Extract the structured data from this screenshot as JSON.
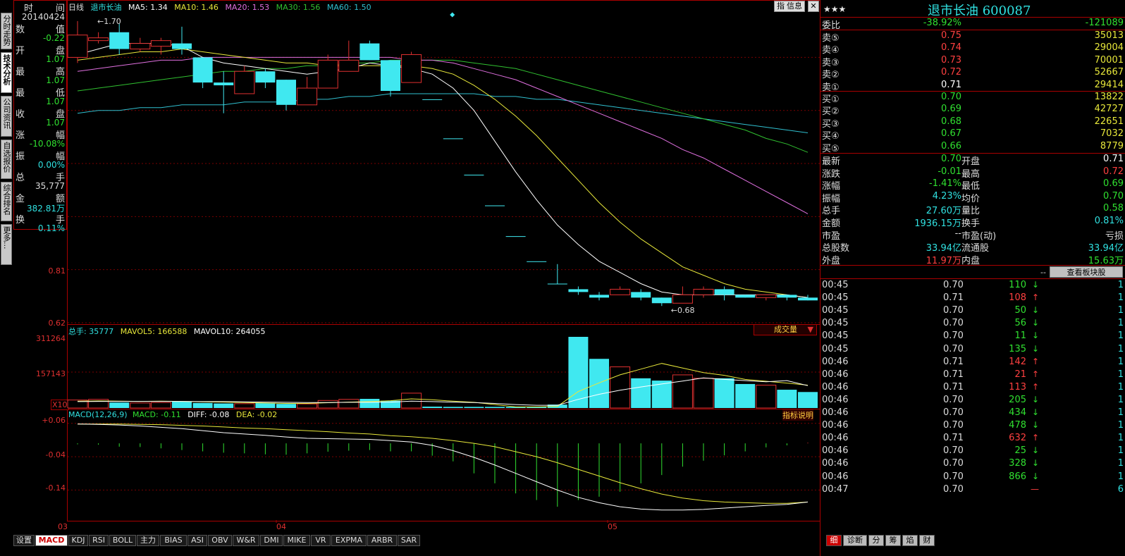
{
  "left_tabs": [
    {
      "label": "分时走势",
      "active": false
    },
    {
      "label": "技术分析",
      "active": true
    },
    {
      "label": "公司资讯",
      "active": false
    },
    {
      "label": "自选报价",
      "active": false
    },
    {
      "label": "综合排名",
      "active": false
    },
    {
      "label": "更多...",
      "active": false
    }
  ],
  "data_window": {
    "time_label_a": "时",
    "time_label_b": "间",
    "date": "20140424",
    "rows": [
      {
        "a": "数",
        "b": "值",
        "value": "-0.22",
        "color": "#30e030"
      },
      {
        "a": "开",
        "b": "盘",
        "value": "1.07",
        "color": "#30e030"
      },
      {
        "a": "最",
        "b": "高",
        "value": "1.07",
        "color": "#30e030"
      },
      {
        "a": "最",
        "b": "低",
        "value": "1.07",
        "color": "#30e030"
      },
      {
        "a": "收",
        "b": "盘",
        "value": "1.07",
        "color": "#30e030"
      },
      {
        "a": "涨",
        "b": "幅",
        "value": "-10.08%",
        "color": "#30e030"
      },
      {
        "a": "振",
        "b": "幅",
        "value": "0.00%",
        "color": "#30e0e0"
      },
      {
        "a": "总",
        "b": "手",
        "value": "35,777",
        "color": "#dddddd"
      },
      {
        "a": "金",
        "b": "额",
        "value": "382.81万",
        "color": "#30e0e0"
      },
      {
        "a": "换",
        "b": "手",
        "value": "0.11%",
        "color": "#30e0e0"
      }
    ]
  },
  "main_chart": {
    "period": "日线",
    "name": "退市长油",
    "ma5": "MA5: 1.34",
    "ma10": "MA10: 1.46",
    "ma20": "MA20: 1.53",
    "ma30": "MA30: 1.56",
    "ma60": "MA60: 1.50",
    "buttons": [
      "指",
      "信息"
    ],
    "y_labels": [
      "0.81",
      "0.62"
    ],
    "high_mark": "1.70",
    "low_mark": "0.68",
    "colors": {
      "ma5": "#ffffff",
      "ma10": "#e8e83a",
      "ma20": "#e070e0",
      "ma30": "#30c030",
      "ma60": "#30c0d0",
      "up": "#e03030",
      "down": "#40e8f0"
    }
  },
  "volume_chart": {
    "total": "总手: 35777",
    "mavol5": "MAVOL5: 166588",
    "mavol10": "MAVOL10: 264055",
    "y_labels": [
      "311264",
      "157143"
    ],
    "unit": "X10",
    "dropdown": "成交量"
  },
  "macd_chart": {
    "title": "MACD(12,26,9)",
    "macd": "MACD: -0.11",
    "diff": "DIFF: -0.08",
    "dea": "DEA: -0.02",
    "help": "指标说明",
    "y_labels": [
      "+0.06",
      "-0.04",
      "-0.14"
    ]
  },
  "x_axis": [
    "03",
    "04",
    "05"
  ],
  "bottom_tabs": [
    "设置",
    "MACD",
    "KDJ",
    "RSI",
    "BOLL",
    "主力",
    "BIAS",
    "ASI",
    "OBV",
    "W&R",
    "DMI",
    "MIKE",
    "VR",
    "EXPMA",
    "ARBR",
    "SAR"
  ],
  "bottom_tab_active": "MACD",
  "right_panel": {
    "stars": "★★★",
    "title": "退市长油 600087",
    "weibi_label": "委比",
    "weibi": "-38.92%",
    "weicha": "-121089",
    "asks": [
      {
        "label": "卖⑤",
        "price": "0.75",
        "vol": "35013",
        "color": "#ff4040"
      },
      {
        "label": "卖④",
        "price": "0.74",
        "vol": "29004",
        "color": "#ff4040"
      },
      {
        "label": "卖③",
        "price": "0.73",
        "vol": "70001",
        "color": "#ff4040"
      },
      {
        "label": "卖②",
        "price": "0.72",
        "vol": "52667",
        "color": "#ff4040"
      },
      {
        "label": "卖①",
        "price": "0.71",
        "vol": "29414",
        "color": "#ffffff"
      }
    ],
    "bids": [
      {
        "label": "买①",
        "price": "0.70",
        "vol": "13822",
        "color": "#30e030"
      },
      {
        "label": "买②",
        "price": "0.69",
        "vol": "42727",
        "color": "#30e030"
      },
      {
        "label": "买③",
        "price": "0.68",
        "vol": "22651",
        "color": "#30e030"
      },
      {
        "label": "买④",
        "price": "0.67",
        "vol": "7032",
        "color": "#30e030"
      },
      {
        "label": "买⑤",
        "price": "0.66",
        "vol": "8779",
        "color": "#30e030"
      }
    ],
    "stats": [
      {
        "l1": "最新",
        "v1": "0.70",
        "c1": "#30e030",
        "l2": "开盘",
        "v2": "0.71",
        "c2": "#ffffff"
      },
      {
        "l1": "涨跌",
        "v1": "-0.01",
        "c1": "#30e030",
        "l2": "最高",
        "v2": "0.72",
        "c2": "#ff4040"
      },
      {
        "l1": "涨幅",
        "v1": "-1.41%",
        "c1": "#30e030",
        "l2": "最低",
        "v2": "0.69",
        "c2": "#30e030"
      },
      {
        "l1": "振幅",
        "v1": "4.23%",
        "c1": "#30e0e0",
        "l2": "均价",
        "v2": "0.70",
        "c2": "#30e030"
      },
      {
        "l1": "总手",
        "v1": "27.60万",
        "c1": "#30e0e0",
        "l2": "量比",
        "v2": "0.58",
        "c2": "#30e030"
      },
      {
        "l1": "金额",
        "v1": "1936.15万",
        "c1": "#30e0e0",
        "l2": "换手",
        "v2": "0.81%",
        "c2": "#30e0e0"
      },
      {
        "l1": "市盈",
        "v1": "--",
        "c1": "#dddddd",
        "l2": "市盈(动)",
        "v2": "亏损",
        "c2": "#dddddd"
      },
      {
        "l1": "总股数",
        "v1": "33.94亿",
        "c1": "#30e0e0",
        "l2": "流通股",
        "v2": "33.94亿",
        "c2": "#30e0e0"
      },
      {
        "l1": "外盘",
        "v1": "11.97万",
        "c1": "#ff4040",
        "l2": "内盘",
        "v2": "15.63万",
        "c2": "#30e030"
      }
    ],
    "sector_dash": "--",
    "sector_button": "查看板块股",
    "ticks": [
      {
        "time": "00:45",
        "price": "0.70",
        "vol": "110",
        "dir": "down",
        "n": "1"
      },
      {
        "time": "00:45",
        "price": "0.71",
        "vol": "108",
        "dir": "up",
        "n": "1"
      },
      {
        "time": "00:45",
        "price": "0.70",
        "vol": "50",
        "dir": "down",
        "n": "1"
      },
      {
        "time": "00:45",
        "price": "0.70",
        "vol": "56",
        "dir": "down",
        "n": "1"
      },
      {
        "time": "00:45",
        "price": "0.70",
        "vol": "11",
        "dir": "down",
        "n": "1"
      },
      {
        "time": "00:45",
        "price": "0.70",
        "vol": "135",
        "dir": "down",
        "n": "1"
      },
      {
        "time": "00:46",
        "price": "0.71",
        "vol": "142",
        "dir": "up",
        "n": "1"
      },
      {
        "time": "00:46",
        "price": "0.71",
        "vol": "21",
        "dir": "up",
        "n": "1"
      },
      {
        "time": "00:46",
        "price": "0.71",
        "vol": "113",
        "dir": "up",
        "n": "1"
      },
      {
        "time": "00:46",
        "price": "0.70",
        "vol": "205",
        "dir": "down",
        "n": "1"
      },
      {
        "time": "00:46",
        "price": "0.70",
        "vol": "434",
        "dir": "down",
        "n": "1"
      },
      {
        "time": "00:46",
        "price": "0.70",
        "vol": "478",
        "dir": "down",
        "n": "1"
      },
      {
        "time": "00:46",
        "price": "0.71",
        "vol": "632",
        "dir": "up",
        "n": "1"
      },
      {
        "time": "00:46",
        "price": "0.70",
        "vol": "25",
        "dir": "down",
        "n": "1"
      },
      {
        "time": "00:46",
        "price": "0.70",
        "vol": "328",
        "dir": "down",
        "n": "1"
      },
      {
        "time": "00:46",
        "price": "0.70",
        "vol": "866",
        "dir": "down",
        "n": "1"
      },
      {
        "time": "00:47",
        "price": "0.70",
        "vol": "",
        "dir": "none",
        "n": "6"
      }
    ],
    "bottom_tabs": [
      "细",
      "诊断",
      "分",
      "筹",
      "焰",
      "财"
    ],
    "bottom_tab_active": "细"
  },
  "chart_data": {
    "type": "candlestick",
    "candles": [
      {
        "o": 1.57,
        "h": 1.7,
        "l": 1.55,
        "c": 1.65,
        "dir": "up"
      },
      {
        "o": 1.64,
        "h": 1.66,
        "l": 1.62,
        "c": 1.63,
        "dir": "up"
      },
      {
        "o": 1.66,
        "h": 1.69,
        "l": 1.58,
        "c": 1.6,
        "dir": "down"
      },
      {
        "o": 1.6,
        "h": 1.64,
        "l": 1.59,
        "c": 1.62,
        "dir": "up"
      },
      {
        "o": 1.63,
        "h": 1.64,
        "l": 1.58,
        "c": 1.61,
        "dir": "up"
      },
      {
        "o": 1.62,
        "h": 1.68,
        "l": 1.58,
        "c": 1.6,
        "dir": "down"
      },
      {
        "o": 1.57,
        "h": 1.57,
        "l": 1.46,
        "c": 1.48,
        "dir": "down"
      },
      {
        "o": 1.48,
        "h": 1.52,
        "l": 1.37,
        "c": 1.47,
        "dir": "down"
      },
      {
        "o": 1.44,
        "h": 1.54,
        "l": 1.44,
        "c": 1.52,
        "dir": "up"
      },
      {
        "o": 1.52,
        "h": 1.53,
        "l": 1.46,
        "c": 1.48,
        "dir": "down"
      },
      {
        "o": 1.49,
        "h": 1.49,
        "l": 1.38,
        "c": 1.4,
        "dir": "down"
      },
      {
        "o": 1.4,
        "h": 1.5,
        "l": 1.4,
        "c": 1.46,
        "dir": "up"
      },
      {
        "o": 1.46,
        "h": 1.58,
        "l": 1.46,
        "c": 1.56,
        "dir": "up"
      },
      {
        "o": 1.52,
        "h": 1.63,
        "l": 1.52,
        "c": 1.56,
        "dir": "up"
      },
      {
        "o": 1.62,
        "h": 1.63,
        "l": 1.56,
        "c": 1.56,
        "dir": "down"
      },
      {
        "o": 1.56,
        "h": 1.56,
        "l": 1.43,
        "c": 1.45,
        "dir": "down"
      },
      {
        "o": 1.48,
        "h": 1.59,
        "l": 1.48,
        "c": 1.58,
        "dir": "up"
      },
      {
        "o": 1.42,
        "h": 1.42,
        "l": 1.42,
        "c": 1.42,
        "dir": "down"
      },
      {
        "o": 1.28,
        "h": 1.28,
        "l": 1.28,
        "c": 1.28,
        "dir": "down"
      },
      {
        "o": 1.15,
        "h": 1.15,
        "l": 1.15,
        "c": 1.15,
        "dir": "down"
      },
      {
        "o": 1.04,
        "h": 1.04,
        "l": 1.04,
        "c": 1.04,
        "dir": "down"
      },
      {
        "o": 0.93,
        "h": 0.93,
        "l": 0.93,
        "c": 0.93,
        "dir": "down"
      },
      {
        "o": 0.84,
        "h": 0.84,
        "l": 0.84,
        "c": 0.84,
        "dir": "down"
      },
      {
        "o": 0.76,
        "h": 0.83,
        "l": 0.76,
        "c": 0.76,
        "dir": "down"
      },
      {
        "o": 0.74,
        "h": 0.75,
        "l": 0.72,
        "c": 0.73,
        "dir": "down"
      },
      {
        "o": 0.72,
        "h": 0.73,
        "l": 0.7,
        "c": 0.71,
        "dir": "down"
      },
      {
        "o": 0.72,
        "h": 0.75,
        "l": 0.72,
        "c": 0.74,
        "dir": "up"
      },
      {
        "o": 0.73,
        "h": 0.74,
        "l": 0.7,
        "c": 0.71,
        "dir": "down"
      },
      {
        "o": 0.71,
        "h": 0.71,
        "l": 0.68,
        "c": 0.69,
        "dir": "down"
      },
      {
        "o": 0.69,
        "h": 0.75,
        "l": 0.69,
        "c": 0.72,
        "dir": "up"
      },
      {
        "o": 0.72,
        "h": 0.75,
        "l": 0.71,
        "c": 0.74,
        "dir": "up"
      },
      {
        "o": 0.74,
        "h": 0.75,
        "l": 0.7,
        "c": 0.72,
        "dir": "down"
      },
      {
        "o": 0.72,
        "h": 0.72,
        "l": 0.71,
        "c": 0.71,
        "dir": "down"
      },
      {
        "o": 0.71,
        "h": 0.72,
        "l": 0.7,
        "c": 0.72,
        "dir": "up"
      },
      {
        "o": 0.72,
        "h": 0.72,
        "l": 0.7,
        "c": 0.71,
        "dir": "down"
      },
      {
        "o": 0.71,
        "h": 0.72,
        "l": 0.7,
        "c": 0.7,
        "dir": "down"
      }
    ],
    "ma5": [
      1.58,
      1.6,
      1.62,
      1.62,
      1.62,
      1.61,
      1.57,
      1.55,
      1.54,
      1.53,
      1.52,
      1.51,
      1.52,
      1.53,
      1.55,
      1.54,
      1.53,
      1.51,
      1.46,
      1.38,
      1.27,
      1.16,
      1.06,
      0.97,
      0.9,
      0.84,
      0.8,
      0.76,
      0.73,
      0.72,
      0.72,
      0.72,
      0.72,
      0.72,
      0.72,
      0.71
    ],
    "ma10": [
      1.56,
      1.57,
      1.58,
      1.59,
      1.59,
      1.6,
      1.59,
      1.58,
      1.57,
      1.56,
      1.55,
      1.55,
      1.54,
      1.54,
      1.54,
      1.54,
      1.54,
      1.53,
      1.51,
      1.47,
      1.42,
      1.36,
      1.29,
      1.21,
      1.13,
      1.05,
      0.98,
      0.92,
      0.87,
      0.82,
      0.79,
      0.76,
      0.74,
      0.73,
      0.72,
      0.71
    ],
    "ma20": [
      1.52,
      1.53,
      1.54,
      1.55,
      1.56,
      1.56,
      1.57,
      1.57,
      1.57,
      1.57,
      1.57,
      1.57,
      1.57,
      1.57,
      1.57,
      1.57,
      1.56,
      1.56,
      1.55,
      1.53,
      1.51,
      1.49,
      1.46,
      1.43,
      1.4,
      1.37,
      1.34,
      1.31,
      1.28,
      1.24,
      1.21,
      1.17,
      1.13,
      1.09,
      1.05,
      1.01
    ],
    "ma30": [
      1.45,
      1.46,
      1.47,
      1.48,
      1.49,
      1.5,
      1.51,
      1.52,
      1.52,
      1.53,
      1.53,
      1.54,
      1.54,
      1.55,
      1.55,
      1.56,
      1.56,
      1.56,
      1.56,
      1.55,
      1.54,
      1.53,
      1.51,
      1.49,
      1.47,
      1.45,
      1.43,
      1.41,
      1.39,
      1.37,
      1.35,
      1.33,
      1.31,
      1.28,
      1.26,
      1.23
    ],
    "ma60": [
      1.37,
      1.38,
      1.38,
      1.39,
      1.39,
      1.4,
      1.4,
      1.4,
      1.41,
      1.41,
      1.41,
      1.42,
      1.42,
      1.43,
      1.43,
      1.44,
      1.44,
      1.44,
      1.44,
      1.44,
      1.43,
      1.43,
      1.42,
      1.42,
      1.41,
      1.4,
      1.39,
      1.38,
      1.37,
      1.36,
      1.35,
      1.34,
      1.33,
      1.32,
      1.31,
      1.3
    ],
    "volume": [
      35000,
      38000,
      24000,
      22000,
      24000,
      28000,
      22000,
      20000,
      19000,
      22000,
      18000,
      18000,
      33000,
      38000,
      40000,
      32000,
      65000,
      6000,
      5000,
      5000,
      5000,
      5000,
      5000,
      15000,
      311264,
      215000,
      180000,
      130000,
      120000,
      145000,
      130000,
      130000,
      105000,
      100000,
      80000,
      70000
    ],
    "mavol5": [
      30000,
      31000,
      30000,
      29000,
      30000,
      29000,
      27000,
      26000,
      24000,
      22000,
      20000,
      20000,
      23000,
      26000,
      28000,
      32000,
      40000,
      36000,
      30000,
      25000,
      15000,
      5000,
      5000,
      7000,
      72000,
      110000,
      145000,
      170000,
      195000,
      175000,
      155000,
      143000,
      125000,
      117000,
      109000,
      100000
    ],
    "mavol10": [
      28000,
      29000,
      29000,
      29000,
      29000,
      29000,
      28000,
      28000,
      27000,
      26000,
      25000,
      24000,
      24000,
      25000,
      25000,
      26000,
      30000,
      28000,
      26000,
      24000,
      20000,
      15000,
      12000,
      12000,
      38000,
      60000,
      78000,
      92000,
      105000,
      118000,
      132000,
      125000,
      120000,
      115000,
      120000,
      98000
    ],
    "diff": [
      0.058,
      0.057,
      0.055,
      0.052,
      0.048,
      0.044,
      0.038,
      0.032,
      0.028,
      0.024,
      0.019,
      0.015,
      0.014,
      0.013,
      0.012,
      0.008,
      0.004,
      -0.006,
      -0.022,
      -0.042,
      -0.065,
      -0.09,
      -0.115,
      -0.14,
      -0.162,
      -0.178,
      -0.19,
      -0.197,
      -0.2,
      -0.2,
      -0.198,
      -0.194,
      -0.19,
      -0.186,
      -0.183,
      -0.176
    ],
    "dea": [
      0.058,
      0.058,
      0.058,
      0.057,
      0.056,
      0.054,
      0.052,
      0.049,
      0.046,
      0.044,
      0.041,
      0.038,
      0.035,
      0.031,
      0.028,
      0.023,
      0.02,
      0.015,
      0.008,
      0.0,
      -0.01,
      -0.025,
      -0.04,
      -0.058,
      -0.078,
      -0.098,
      -0.118,
      -0.136,
      -0.152,
      -0.164,
      -0.172,
      -0.176,
      -0.178,
      -0.18,
      -0.18,
      -0.176
    ],
    "macd_bars": [
      -0.003,
      -0.004,
      -0.01,
      -0.011,
      -0.015,
      -0.02,
      -0.024,
      -0.028,
      -0.03,
      -0.033,
      -0.034,
      -0.03,
      -0.025,
      -0.022,
      -0.02,
      -0.024,
      -0.024,
      -0.037,
      -0.054,
      -0.09,
      -0.12,
      -0.15,
      -0.17,
      -0.19,
      -0.17,
      -0.16,
      -0.145,
      -0.12,
      -0.095,
      -0.07,
      -0.052,
      -0.036,
      -0.024,
      -0.012,
      -0.006,
      0.002
    ],
    "price_range": [
      0.62,
      1.73
    ],
    "volume_max": 311264,
    "macd_range": [
      -0.23,
      0.07
    ],
    "x_labels": [
      "03",
      "04",
      "05"
    ]
  }
}
